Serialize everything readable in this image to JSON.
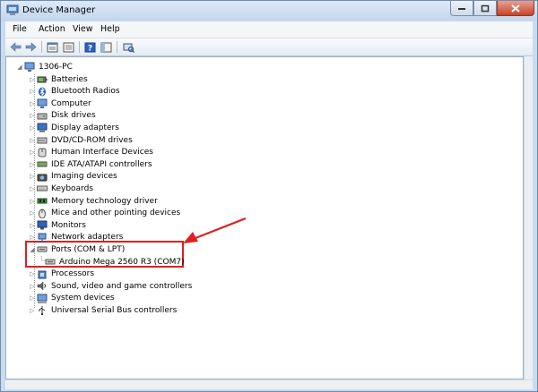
{
  "window": {
    "title": "Device Manager"
  },
  "menu": [
    "File",
    "Action",
    "View",
    "Help"
  ],
  "toolbar": {
    "buttons": [
      "back-icon",
      "forward-icon",
      "properties-icon",
      "tree-icon",
      "help-icon",
      "panel-icon",
      "scan-hardware-icon"
    ]
  },
  "tree": {
    "root": "1306-PC",
    "items": [
      {
        "label": "Batteries",
        "icon": "battery-icon"
      },
      {
        "label": "Bluetooth Radios",
        "icon": "bluetooth-icon"
      },
      {
        "label": "Computer",
        "icon": "computer-icon"
      },
      {
        "label": "Disk drives",
        "icon": "disk-icon"
      },
      {
        "label": "Display adapters",
        "icon": "display-icon"
      },
      {
        "label": "DVD/CD-ROM drives",
        "icon": "dvd-icon"
      },
      {
        "label": "Human Interface Devices",
        "icon": "hid-icon"
      },
      {
        "label": "IDE ATA/ATAPI controllers",
        "icon": "ide-icon"
      },
      {
        "label": "Imaging devices",
        "icon": "camera-icon"
      },
      {
        "label": "Keyboards",
        "icon": "keyboard-icon"
      },
      {
        "label": "Memory technology driver",
        "icon": "memory-icon"
      },
      {
        "label": "Mice and other pointing devices",
        "icon": "mouse-icon"
      },
      {
        "label": "Monitors",
        "icon": "monitor-icon"
      },
      {
        "label": "Network adapters",
        "icon": "network-icon"
      },
      {
        "label": "Ports (COM & LPT)",
        "icon": "port-icon",
        "expanded": true
      },
      {
        "label": "Arduino Mega 2560 R3 (COM7)",
        "icon": "port-icon",
        "child": true
      },
      {
        "label": "Processors",
        "icon": "processor-icon"
      },
      {
        "label": "Sound, video and game controllers",
        "icon": "sound-icon"
      },
      {
        "label": "System devices",
        "icon": "system-icon"
      },
      {
        "label": "Universal Serial Bus controllers",
        "icon": "usb-icon"
      }
    ]
  },
  "colors": {
    "highlight": "#e02020",
    "tree_line": "#a0a0a0"
  }
}
